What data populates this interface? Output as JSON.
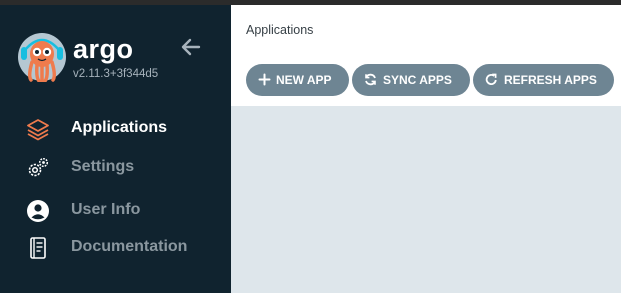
{
  "sidebar": {
    "brand": "argo",
    "version": "v2.11.3+3f344d5",
    "items": [
      {
        "label": "Applications",
        "icon": "layers-icon"
      },
      {
        "label": "Settings",
        "icon": "gears-icon"
      },
      {
        "label": "User Info",
        "icon": "user-circle-icon"
      },
      {
        "label": "Documentation",
        "icon": "book-icon"
      }
    ]
  },
  "header": {
    "title": "Applications"
  },
  "toolbar": {
    "new_app": "NEW APP",
    "sync_apps": "SYNC APPS",
    "refresh_apps": "REFRESH APPS"
  },
  "colors": {
    "sidebar_bg": "#10232f",
    "accent": "#ef7b4d",
    "button": "#6e8593",
    "content_bg": "#dee6eb"
  }
}
